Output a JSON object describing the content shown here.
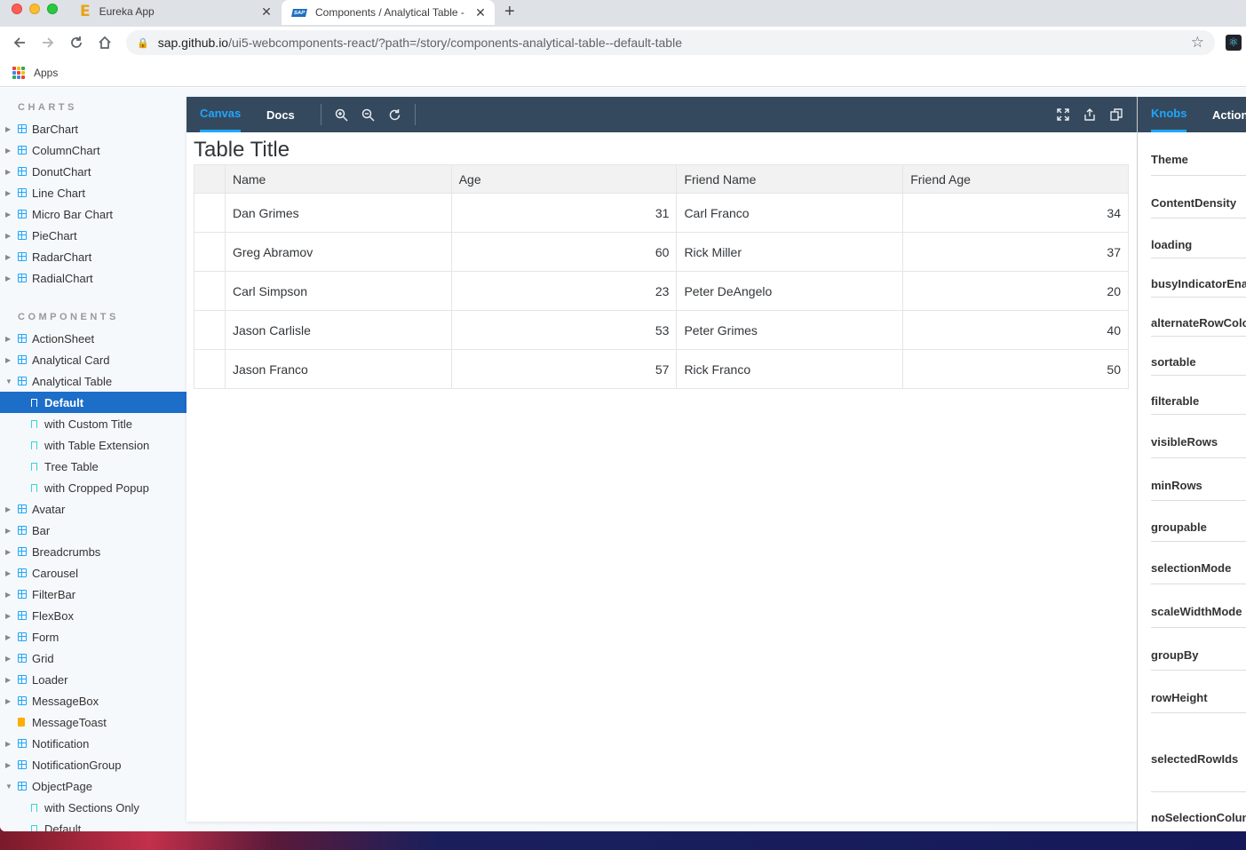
{
  "browser": {
    "tabs": [
      {
        "title": "Eureka App",
        "favicon": "E"
      },
      {
        "title": "Components / Analytical Table -",
        "favicon": "SAP"
      }
    ],
    "url_host": "sap.github.io",
    "url_path": "/ui5-webcomponents-react/?path=/story/components-analytical-table--default-table",
    "bookmarks_apps_label": "Apps"
  },
  "sidebar": {
    "charts_heading": "CHARTS",
    "charts": [
      "BarChart",
      "ColumnChart",
      "DonutChart",
      "Line Chart",
      "Micro Bar Chart",
      "PieChart",
      "RadarChart",
      "RadialChart"
    ],
    "components_heading": "COMPONENTS",
    "components_before": [
      "ActionSheet",
      "Analytical Card"
    ],
    "expanded_component": "Analytical Table",
    "stories": [
      "Default",
      "with Custom Title",
      "with Table Extension",
      "Tree Table",
      "with Cropped Popup"
    ],
    "active_story": "Default",
    "components_after": [
      "Avatar",
      "Bar",
      "Breadcrumbs",
      "Carousel",
      "FilterBar",
      "FlexBox",
      "Form",
      "Grid",
      "Loader",
      "MessageBox"
    ],
    "doc_item": "MessageToast",
    "components_after2": [
      "Notification",
      "NotificationGroup"
    ],
    "expanded_component_2": "ObjectPage",
    "object_page_stories": [
      "with Sections Only",
      "Default"
    ]
  },
  "preview": {
    "tabs": [
      "Canvas",
      "Docs"
    ],
    "active_tab": "Canvas",
    "table_title": "Table Title",
    "columns": [
      "Name",
      "Age",
      "Friend Name",
      "Friend Age"
    ],
    "rows": [
      [
        "Dan Grimes",
        "31",
        "Carl Franco",
        "34"
      ],
      [
        "Greg Abramov",
        "60",
        "Rick Miller",
        "37"
      ],
      [
        "Carl Simpson",
        "23",
        "Peter DeAngelo",
        "20"
      ],
      [
        "Jason Carlisle",
        "53",
        "Peter Grimes",
        "40"
      ],
      [
        "Jason Franco",
        "57",
        "Rick Franco",
        "50"
      ]
    ]
  },
  "addons": {
    "tabs": [
      "Knobs",
      "Actions"
    ],
    "knobs": [
      "Theme",
      "ContentDensity",
      "loading",
      "busyIndicatorEnabled",
      "alternateRowColor",
      "sortable",
      "filterable",
      "visibleRows",
      "minRows",
      "groupable",
      "selectionMode",
      "scaleWidthMode",
      "groupBy",
      "rowHeight",
      "selectedRowIds",
      "noSelectionColumn"
    ]
  },
  "colors": {
    "accent": "#1ea7fd",
    "active_story_bg": "#1d6ec9",
    "toolbar_bg": "#35495e"
  }
}
